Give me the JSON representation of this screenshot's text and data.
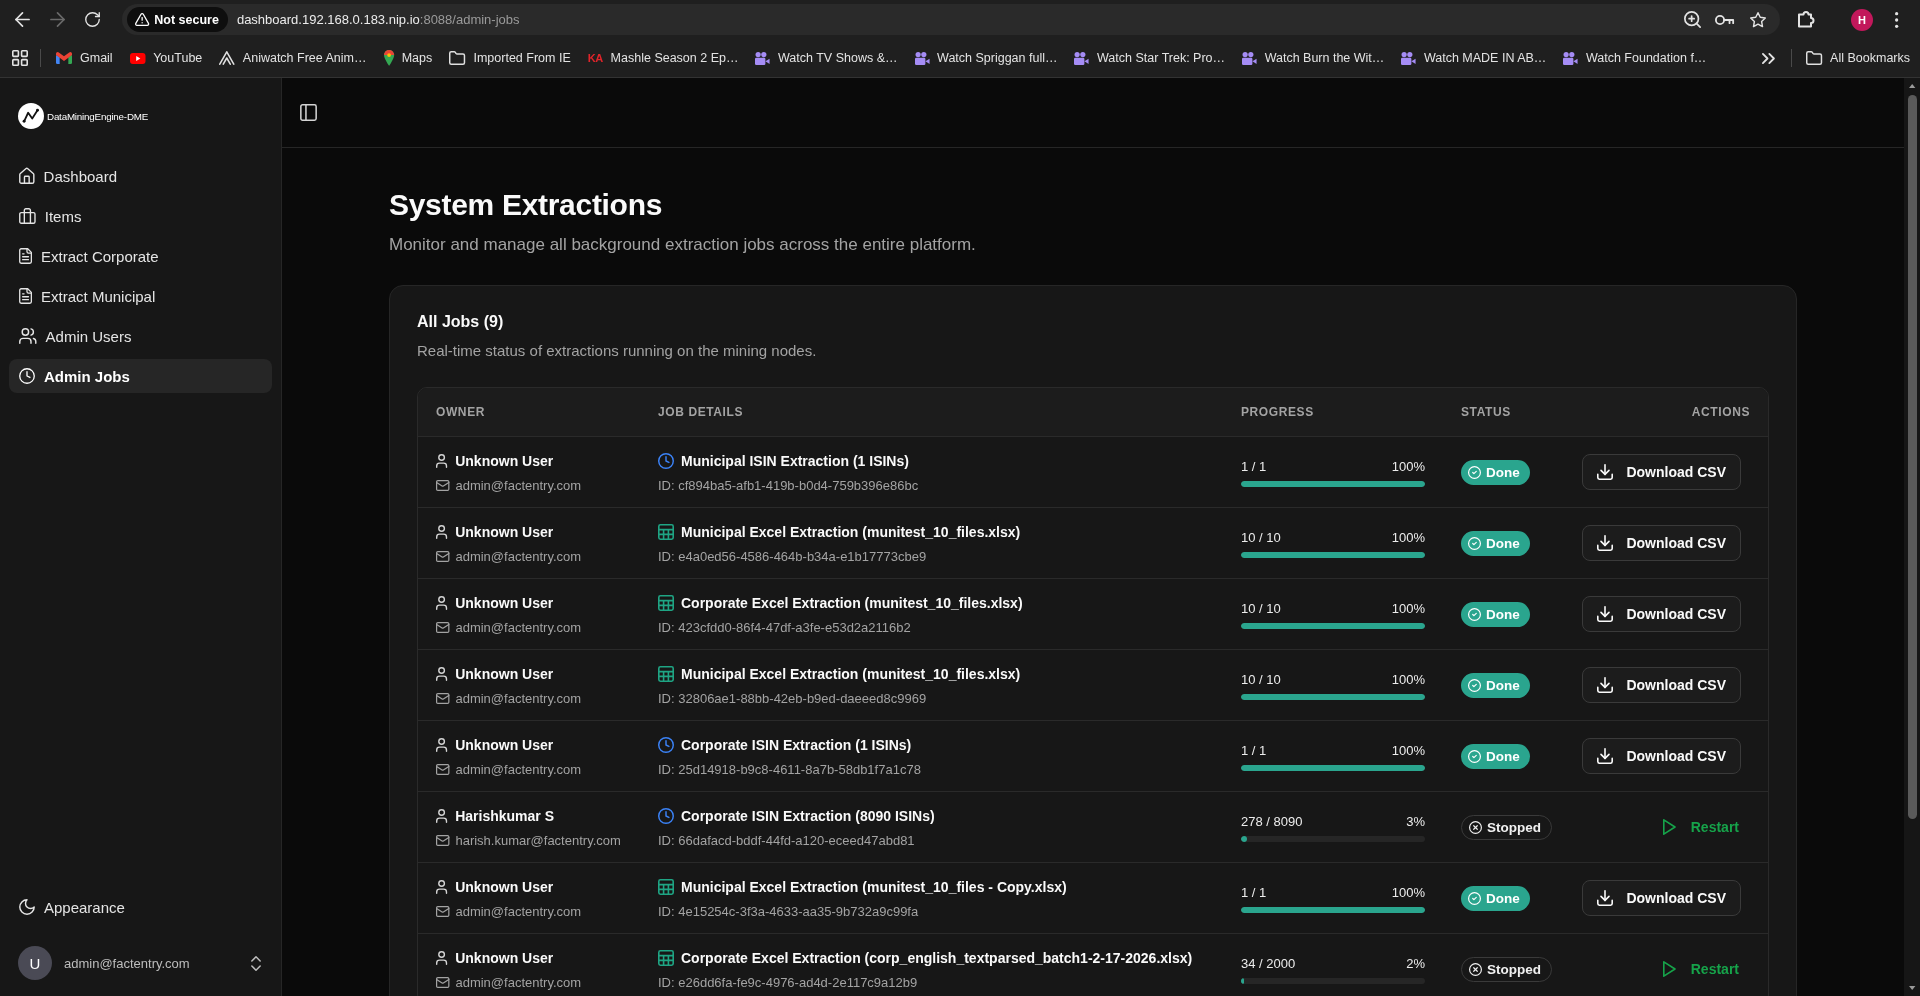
{
  "browser": {
    "nav_buttons": [
      {
        "kind": "back",
        "disabled": false
      },
      {
        "kind": "forward",
        "disabled": true
      },
      {
        "kind": "reload",
        "disabled": false
      }
    ],
    "security_label": "Not secure",
    "url_host": "dashboard.192.168.0.183.nip.io",
    "url_path": ":8088/admin-jobs",
    "profile_initial": "H",
    "bookmarks": [
      {
        "kind": "mail",
        "label": "Gmail"
      },
      {
        "kind": "video_logo",
        "label": "YouTube"
      },
      {
        "kind": "outline_logo",
        "label": "Aniwatch Free Anim…"
      },
      {
        "kind": "map_pin",
        "label": "Maps"
      },
      {
        "kind": "folder",
        "label": "Imported From IE"
      },
      {
        "kind": "letters",
        "favicon_text": "KA",
        "label": "Mashle Season 2 Ep…"
      },
      {
        "kind": "camera",
        "label": "Watch TV Shows &…"
      },
      {
        "kind": "camera",
        "label": "Watch Spriggan full…"
      },
      {
        "kind": "camera",
        "label": "Watch Star Trek: Pro…"
      },
      {
        "kind": "camera",
        "label": "Watch Burn the Wit…"
      },
      {
        "kind": "camera",
        "label": "Watch MADE IN AB…"
      },
      {
        "kind": "camera",
        "label": "Watch Foundation f…"
      }
    ],
    "all_bookmarks": "All Bookmarks"
  },
  "sidebar": {
    "app_name": "DataMiningEngine-DME",
    "items": [
      {
        "kind": "home",
        "label": "Dashboard",
        "selected": false
      },
      {
        "kind": "briefcase",
        "label": "Items",
        "selected": false
      },
      {
        "kind": "document",
        "label": "Extract Corporate",
        "selected": false
      },
      {
        "kind": "document",
        "label": "Extract Municipal",
        "selected": false
      },
      {
        "kind": "users",
        "label": "Admin Users",
        "selected": false
      },
      {
        "kind": "clock",
        "label": "Admin Jobs",
        "selected": true
      }
    ],
    "appearance": "Appearance",
    "account": {
      "initial": "U",
      "email": "admin@factentry.com"
    }
  },
  "page": {
    "title": "System Extractions",
    "subtitle": "Monitor and manage all background extraction jobs across the entire platform."
  },
  "jobs_card": {
    "title": "All Jobs (9)",
    "description": "Real-time status of extractions running on the mining nodes."
  },
  "table": {
    "columns": [
      "OWNER",
      "JOB DETAILS",
      "PROGRESS",
      "STATUS",
      "ACTIONS"
    ],
    "rows": [
      {
        "owner": {
          "name": "Unknown User",
          "email": "admin@factentry.com"
        },
        "job": {
          "kind": "isin",
          "title": "Municipal ISIN Extraction (1 ISINs)",
          "id": "ID: cf894ba5-afb1-419b-b0d4-759b396e86bc"
        },
        "progress": {
          "count": "1 / 1",
          "percent": "100%",
          "level": 1
        },
        "status": {
          "kind": "done",
          "label": "Done"
        },
        "action": {
          "kind": "download",
          "label": "Download CSV"
        }
      },
      {
        "owner": {
          "name": "Unknown User",
          "email": "admin@factentry.com"
        },
        "job": {
          "kind": "excel",
          "title": "Municipal Excel Extraction (munitest_10_files.xlsx)",
          "id": "ID: e4a0ed56-4586-464b-b34a-e1b17773cbe9"
        },
        "progress": {
          "count": "10 / 10",
          "percent": "100%",
          "level": 1
        },
        "status": {
          "kind": "done",
          "label": "Done"
        },
        "action": {
          "kind": "download",
          "label": "Download CSV"
        }
      },
      {
        "owner": {
          "name": "Unknown User",
          "email": "admin@factentry.com"
        },
        "job": {
          "kind": "excel",
          "title": "Corporate Excel Extraction (munitest_10_files.xlsx)",
          "id": "ID: 423cfdd0-86f4-47df-a3fe-e53d2a2116b2"
        },
        "progress": {
          "count": "10 / 10",
          "percent": "100%",
          "level": 1
        },
        "status": {
          "kind": "done",
          "label": "Done"
        },
        "action": {
          "kind": "download",
          "label": "Download CSV"
        }
      },
      {
        "owner": {
          "name": "Unknown User",
          "email": "admin@factentry.com"
        },
        "job": {
          "kind": "excel",
          "title": "Municipal Excel Extraction (munitest_10_files.xlsx)",
          "id": "ID: 32806ae1-88bb-42eb-b9ed-daeeed8c9969"
        },
        "progress": {
          "count": "10 / 10",
          "percent": "100%",
          "level": 1
        },
        "status": {
          "kind": "done",
          "label": "Done"
        },
        "action": {
          "kind": "download",
          "label": "Download CSV"
        }
      },
      {
        "owner": {
          "name": "Unknown User",
          "email": "admin@factentry.com"
        },
        "job": {
          "kind": "isin",
          "title": "Corporate ISIN Extraction (1 ISINs)",
          "id": "ID: 25d14918-b9c8-4611-8a7b-58db1f7a1c78"
        },
        "progress": {
          "count": "1 / 1",
          "percent": "100%",
          "level": 1
        },
        "status": {
          "kind": "done",
          "label": "Done"
        },
        "action": {
          "kind": "download",
          "label": "Download CSV"
        }
      },
      {
        "owner": {
          "name": "Harishkumar S",
          "email": "harish.kumar@factentry.com"
        },
        "job": {
          "kind": "isin",
          "title": "Corporate ISIN Extraction (8090 ISINs)",
          "id": "ID: 66dafacd-bddf-44fd-a120-eceed47abd81"
        },
        "progress": {
          "count": "278 / 8090",
          "percent": "3%",
          "level": 0.034
        },
        "status": {
          "kind": "stopped",
          "label": "Stopped"
        },
        "action": {
          "kind": "restart",
          "label": "Restart"
        }
      },
      {
        "owner": {
          "name": "Unknown User",
          "email": "admin@factentry.com"
        },
        "job": {
          "kind": "excel",
          "title": "Municipal Excel Extraction (munitest_10_files - Copy.xlsx)",
          "id": "ID: 4e15254c-3f3a-4633-aa35-9b732a9c99fa"
        },
        "progress": {
          "count": "1 / 1",
          "percent": "100%",
          "level": 1
        },
        "status": {
          "kind": "done",
          "label": "Done"
        },
        "action": {
          "kind": "download",
          "label": "Download CSV"
        }
      },
      {
        "owner": {
          "name": "Unknown User",
          "email": "admin@factentry.com"
        },
        "job": {
          "kind": "excel",
          "title": "Corporate Excel Extraction (corp_english_textparsed_batch1-2-17-2026.xlsx)",
          "id": "ID: e26dd6fa-fe9c-4976-ad4d-2e117c9a12b9"
        },
        "progress": {
          "count": "34 / 2000",
          "percent": "2%",
          "level": 0.017
        },
        "status": {
          "kind": "stopped",
          "label": "Stopped"
        },
        "action": {
          "kind": "restart",
          "label": "Restart"
        }
      }
    ]
  }
}
